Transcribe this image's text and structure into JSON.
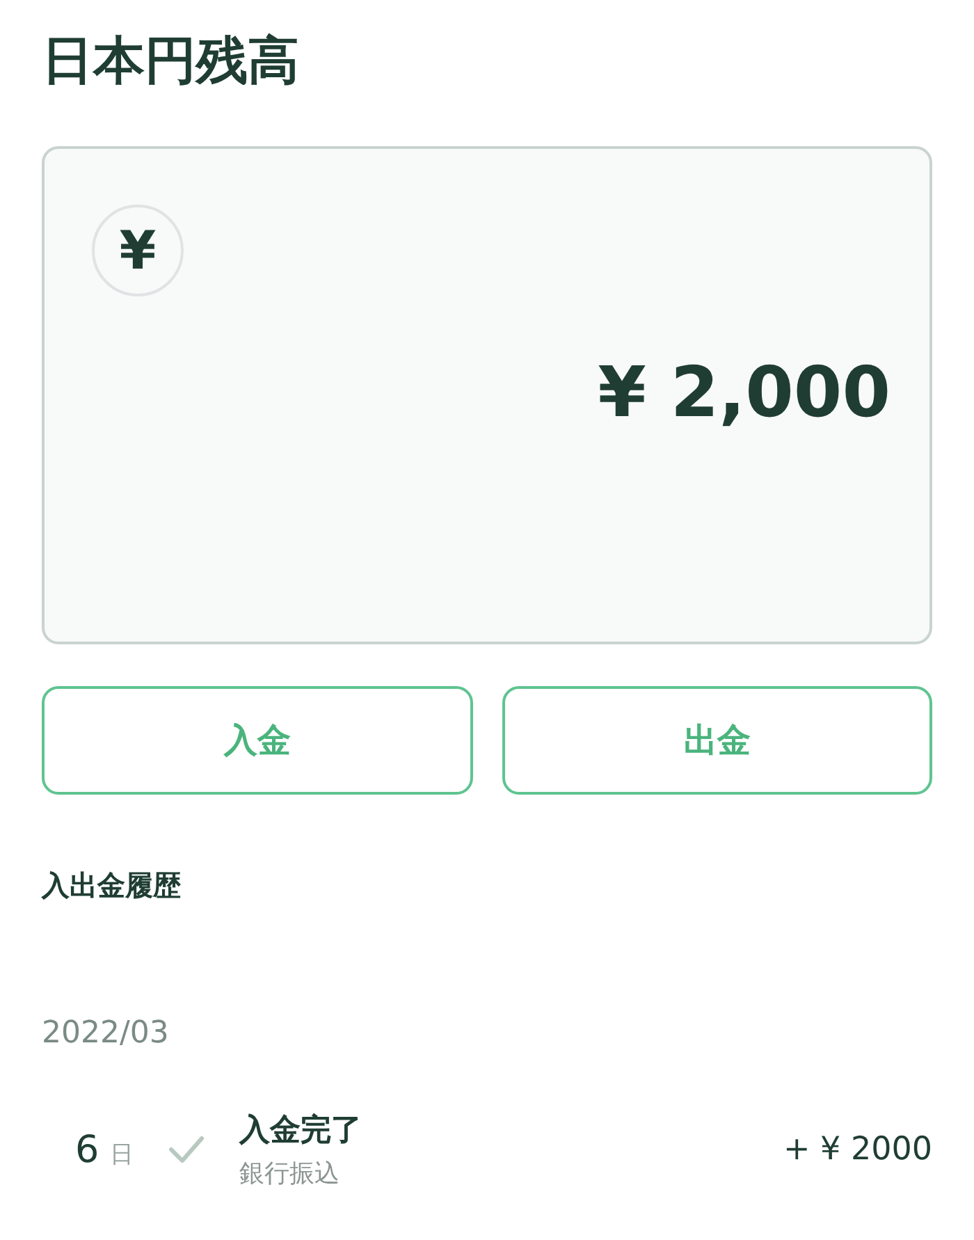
{
  "title": "日本円残高",
  "balance_card": {
    "currency_symbol": "¥",
    "amount": "¥ 2,000"
  },
  "buttons": [
    "入金",
    "出金"
  ],
  "history": {
    "heading": "入出金履歴",
    "groups": [
      {
        "month": "2022/03",
        "entries": [
          {
            "day": "6",
            "day_unit": "日",
            "completed": true,
            "title": "入金完了",
            "method": "銀行振込",
            "amount": "+ ¥ 2000"
          }
        ]
      }
    ]
  }
}
